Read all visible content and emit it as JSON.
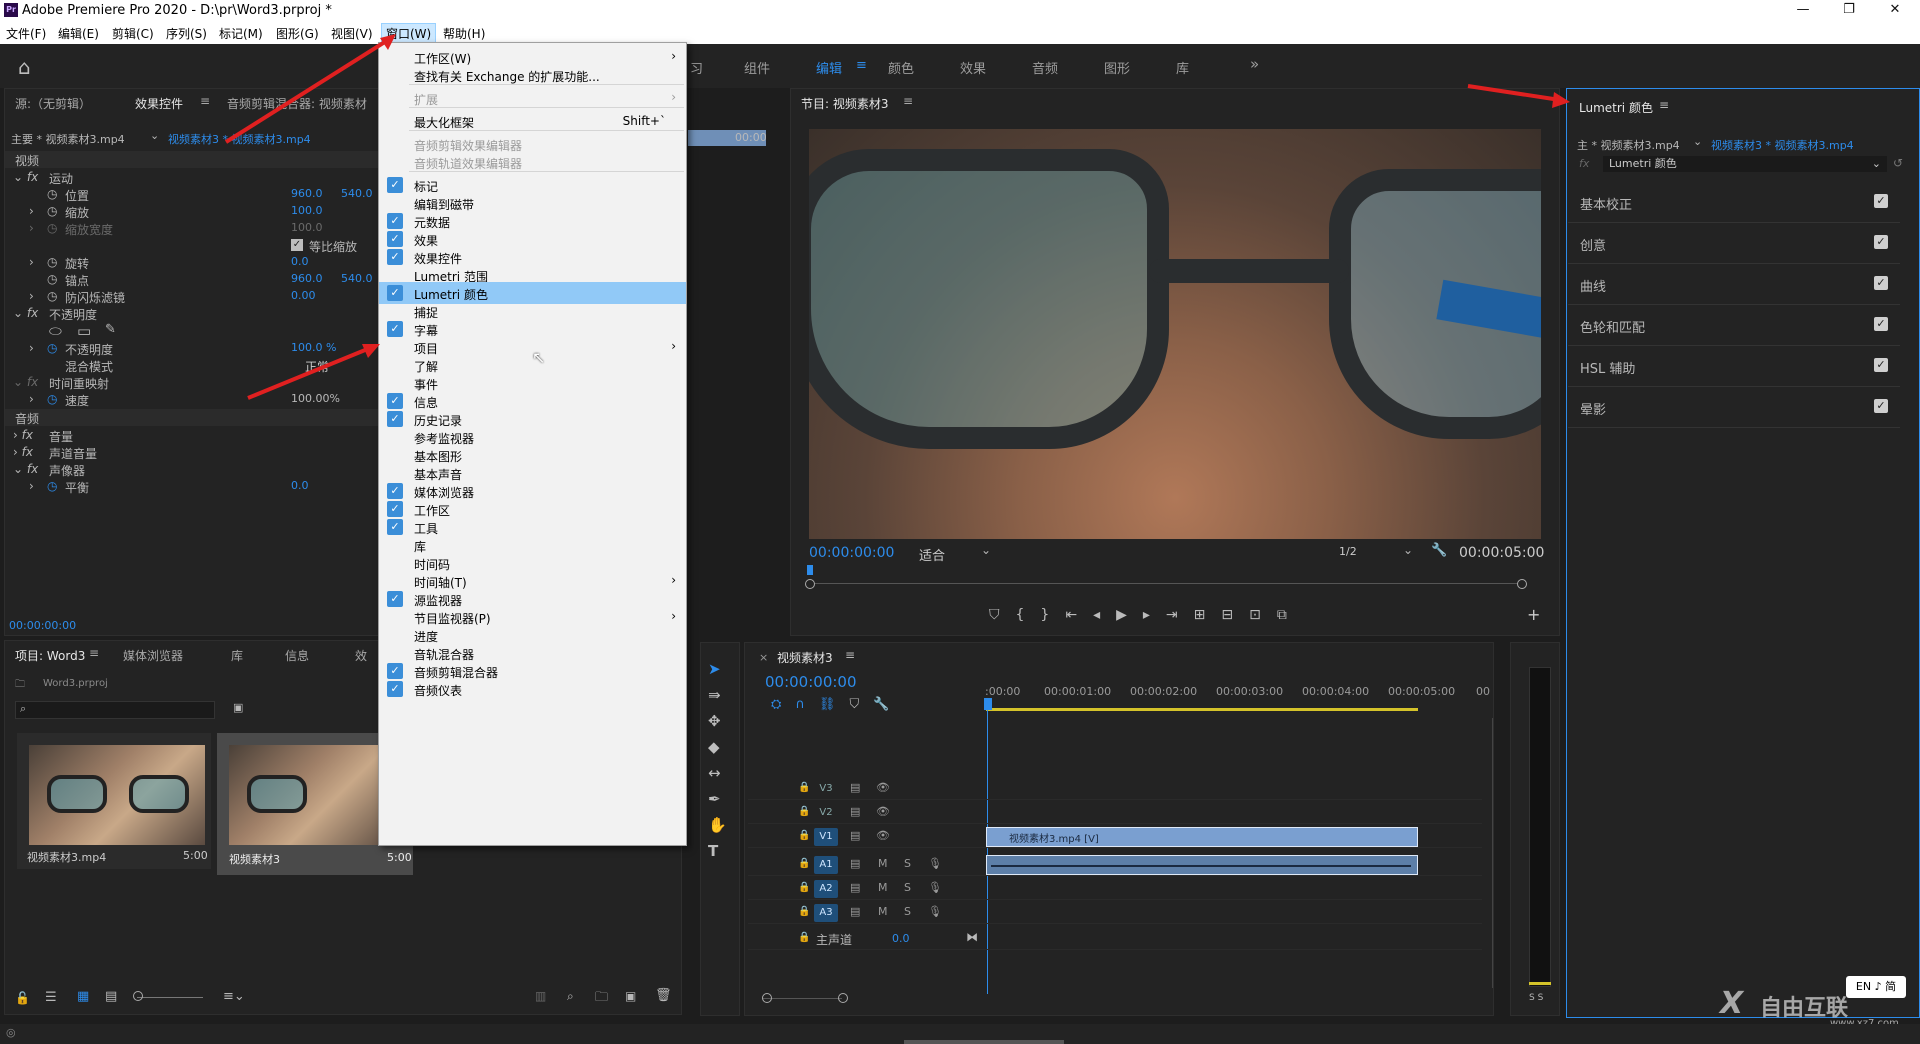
{
  "titlebar": {
    "app_badge": "Pr",
    "title": "Adobe Premiere Pro 2020 - D:\\pr\\Word3.prproj *",
    "minimize": "—",
    "maximize": "❐",
    "close": "✕"
  },
  "menubar": {
    "items": [
      "文件(F)",
      "编辑(E)",
      "剪辑(C)",
      "序列(S)",
      "标记(M)",
      "图形(G)",
      "视图(V)",
      "窗口(W)",
      "帮助(H)"
    ],
    "active_index": 7
  },
  "workspaces": {
    "tabs": [
      "习",
      "组件",
      "编辑",
      "颜色",
      "效果",
      "音频",
      "图形",
      "库"
    ],
    "active": "编辑",
    "more": "»"
  },
  "source_panel": {
    "tabs": [
      "源:（无剪辑）",
      "效果控件",
      "音频剪辑混合器: 视频素材"
    ],
    "clip_master": "主要 * 视频素材3.mp4",
    "clip_seq": "视频素材3 * 视频素材3.mp4",
    "time_start": "00:00",
    "section_video": "视频",
    "motion": "运动",
    "position": {
      "label": "位置",
      "x": "960.0",
      "y": "540.0"
    },
    "scale": {
      "label": "缩放",
      "value": "100.0"
    },
    "scale_width": {
      "label": "缩放宽度",
      "value": "100.0"
    },
    "uniform_scale": "等比缩放",
    "rotation": {
      "label": "旋转",
      "value": "0.0"
    },
    "anchor": {
      "label": "锚点",
      "x": "960.0",
      "y": "540.0"
    },
    "anti_flicker": {
      "label": "防闪烁滤镜",
      "value": "0.00"
    },
    "opacity_section": "不透明度",
    "opacity": {
      "label": "不透明度",
      "value": "100.0 %"
    },
    "blend_mode": {
      "label": "混合模式",
      "value": "正常"
    },
    "time_remap": "时间重映射",
    "speed": {
      "label": "速度",
      "value": "100.00%"
    },
    "section_audio": "音频",
    "volume": "音量",
    "channel_volume": "声道音量",
    "panner": "声像器",
    "balance": {
      "label": "平衡",
      "value": "0.0"
    },
    "timecode": "00:00:00:00"
  },
  "project_panel": {
    "tabs": [
      "项目: Word3",
      "媒体浏览器",
      "库",
      "信息",
      "效"
    ],
    "file": "Word3.prproj",
    "items": [
      {
        "name": "视频素材3.mp4",
        "duration": "5:00"
      },
      {
        "name": "视频素材3",
        "duration": "5:00"
      }
    ]
  },
  "window_menu": {
    "items": [
      {
        "label": "工作区(W)",
        "submenu": true
      },
      {
        "label": "查找有关 Exchange 的扩展功能..."
      },
      {
        "sep": true
      },
      {
        "label": "扩展",
        "disabled": true,
        "submenu": true
      },
      {
        "sep": true
      },
      {
        "label": "最大化框架",
        "shortcut": "Shift+`"
      },
      {
        "sep": true
      },
      {
        "label": "音频剪辑效果编辑器",
        "disabled": true
      },
      {
        "label": "音频轨道效果编辑器",
        "disabled": true
      },
      {
        "sep": true
      },
      {
        "label": "标记",
        "checked": true
      },
      {
        "label": "编辑到磁带"
      },
      {
        "label": "元数据",
        "checked": true
      },
      {
        "label": "效果",
        "checked": true
      },
      {
        "label": "效果控件",
        "checked": true
      },
      {
        "label": "Lumetri 范围"
      },
      {
        "label": "Lumetri 颜色",
        "checked": true,
        "highlight": true
      },
      {
        "label": "捕捉"
      },
      {
        "label": "字幕",
        "checked": true
      },
      {
        "label": "项目",
        "submenu": true
      },
      {
        "label": "了解"
      },
      {
        "label": "事件"
      },
      {
        "label": "信息",
        "checked": true
      },
      {
        "label": "历史记录",
        "checked": true
      },
      {
        "label": "参考监视器"
      },
      {
        "label": "基本图形"
      },
      {
        "label": "基本声音"
      },
      {
        "label": "媒体浏览器",
        "checked": true
      },
      {
        "label": "工作区",
        "checked": true
      },
      {
        "label": "工具",
        "checked": true
      },
      {
        "label": "库"
      },
      {
        "label": "时间码"
      },
      {
        "label": "时间轴(T)",
        "submenu": true
      },
      {
        "label": "源监视器",
        "checked": true
      },
      {
        "label": "节目监视器(P)",
        "submenu": true
      },
      {
        "label": "进度"
      },
      {
        "label": "音轨混合器"
      },
      {
        "label": "音频剪辑混合器",
        "checked": true
      },
      {
        "label": "音频仪表",
        "checked": true
      }
    ]
  },
  "program_monitor": {
    "title": "节目: 视频素材3",
    "timecode": "00:00:00:00",
    "fit": "适合",
    "resolution": "1/2",
    "duration": "00:00:05:00"
  },
  "timeline": {
    "title": "视频素材3",
    "timecode": "00:00:00:00",
    "ruler": [
      ":00:00",
      "00:00:01:00",
      "00:00:02:00",
      "00:00:03:00",
      "00:00:04:00",
      "00:00:05:00",
      "00"
    ],
    "tracks": [
      "V3",
      "V2",
      "V1",
      "A1",
      "A2",
      "A3"
    ],
    "master": {
      "label": "主声道",
      "value": "0.0"
    },
    "clip_video": "视频素材3.mp4 [V]",
    "mute": "M",
    "solo": "S"
  },
  "lumetri": {
    "title": "Lumetri 颜色",
    "clip_master": "主 * 视频素材3.mp4",
    "clip_seq": "视频素材3 * 视频素材3.mp4",
    "effect": "Lumetri 颜色",
    "sections": [
      "基本校正",
      "创意",
      "曲线",
      "色轮和匹配",
      "HSL 辅助",
      "晕影"
    ]
  },
  "meter": {
    "labels": "S S"
  },
  "ime": "EN ♪ 简",
  "watermark": "自由互联",
  "watermark_url": "www.xz7.com"
}
